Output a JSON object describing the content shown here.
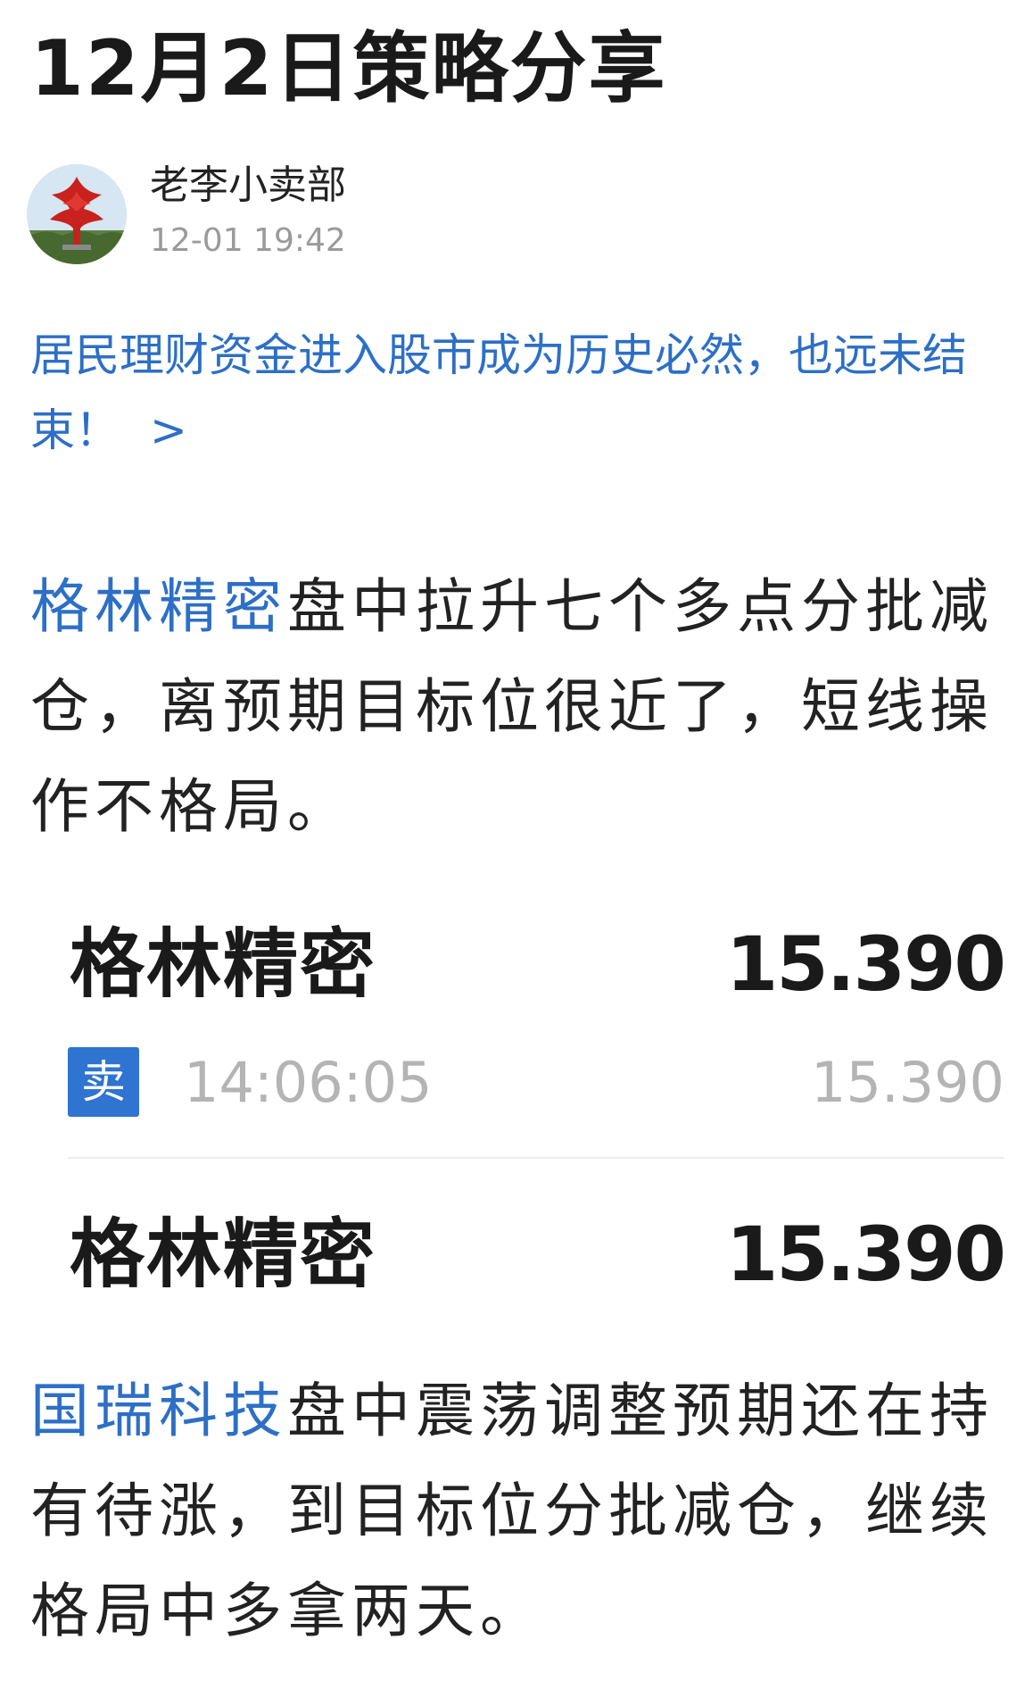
{
  "article": {
    "title": "12月2日策略分享"
  },
  "author": {
    "name": "老李小卖部",
    "time": "12-01 19:42",
    "avatar_icon": "avatar-tower-icon"
  },
  "promo": {
    "text": "居民理财资金进入股市成为历史必然，也远未结束！",
    "chevron": ">"
  },
  "paragraph1": {
    "stock": "格林精密",
    "text": "盘中拉升七个多点分批减仓，离预期目标位很近了，短线操作不格局。"
  },
  "trade_card": {
    "row1": {
      "name": "格林精密",
      "price": "15.390"
    },
    "detail": {
      "badge": "卖",
      "badge_color": "#2f74d0",
      "time": "14:06:05",
      "price": "15.390"
    },
    "row2": {
      "name": "格林精密",
      "price": "15.390"
    }
  },
  "paragraph2": {
    "stock": "国瑞科技",
    "text": "盘中震荡调整预期还在持有待涨，到目标位分批减仓，继续格局中多拿两天。"
  },
  "colors": {
    "link": "#2d6fc6",
    "text": "#222222",
    "muted": "#9a9a9a"
  }
}
